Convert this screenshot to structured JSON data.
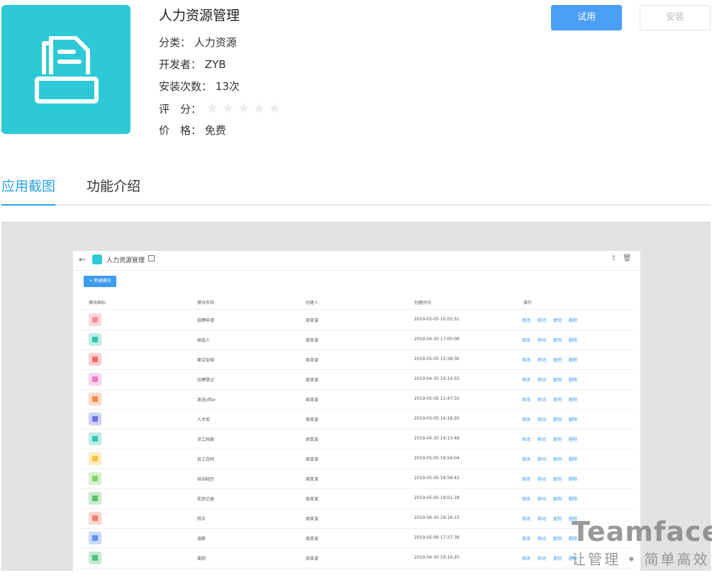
{
  "app": {
    "title": "人力资源管理",
    "category_label": "分类：",
    "category": "人力资源",
    "developer_label": "开发者：",
    "developer": "ZYB",
    "installs_label": "安装次数：",
    "installs": "13次",
    "rating_label": "评　分：",
    "rating": 0,
    "price_label": "价　格：",
    "price": "免费",
    "icon": "document-tray-icon",
    "accent_color": "#2ec9d6"
  },
  "buttons": {
    "try": "试用",
    "install": "安装"
  },
  "tabs": [
    {
      "label": "应用截图",
      "active": true
    },
    {
      "label": "功能介绍",
      "active": false
    }
  ],
  "screenshot": {
    "title": "人力资源管理",
    "new_button": "+ 新建模块",
    "headers": [
      "模块图标",
      "模块名称",
      "创建人",
      "创建时间",
      "操作"
    ],
    "actions": [
      "修改",
      "移动",
      "复制",
      "删除"
    ],
    "rows": [
      {
        "name": "招聘申请",
        "creator": "周亚波",
        "time": "2019-05-05 10:05:52",
        "color": "#f58a9a"
      },
      {
        "name": "候选人",
        "creator": "周亚波",
        "time": "2019-04-30 17:00:08",
        "color": "#36c5b0"
      },
      {
        "name": "面试安排",
        "creator": "周亚波",
        "time": "2019-05-05 15:38:36",
        "color": "#f16a6a"
      },
      {
        "name": "应聘登记",
        "creator": "周亚波",
        "time": "2019-04-30 19:14:55",
        "color": "#ee7bc9"
      },
      {
        "name": "发送offer",
        "creator": "周亚波",
        "time": "2019-05-05 15:47:50",
        "color": "#f6874f"
      },
      {
        "name": "人才库",
        "creator": "周亚波",
        "time": "2019-05-05 16:18:20",
        "color": "#6b74e6"
      },
      {
        "name": "员工档案",
        "creator": "周亚波",
        "time": "2019-04-30 19:13:48",
        "color": "#36c5b0"
      },
      {
        "name": "员工合同",
        "creator": "周亚波",
        "time": "2019-05-05 18:54:04",
        "color": "#f7c53c"
      },
      {
        "name": "培训经历",
        "creator": "周亚波",
        "time": "2019-05-05 18:58:42",
        "color": "#7fd46a"
      },
      {
        "name": "奖惩记录",
        "creator": "周亚波",
        "time": "2019-05-05 19:01:18",
        "color": "#58c36a"
      },
      {
        "name": "转正",
        "creator": "周亚波",
        "time": "2019-04-30 19:16:13",
        "color": "#f27e6d"
      },
      {
        "name": "调薪",
        "creator": "周亚波",
        "time": "2019-05-06 17:37:38",
        "color": "#5c8ef0"
      },
      {
        "name": "离职",
        "creator": "周亚波",
        "time": "2019-04-30 19:16:20",
        "color": "#4fbf7a"
      }
    ]
  },
  "watermark": {
    "brand": "Teamface",
    "slogan": "让管理 • 简单高效"
  }
}
